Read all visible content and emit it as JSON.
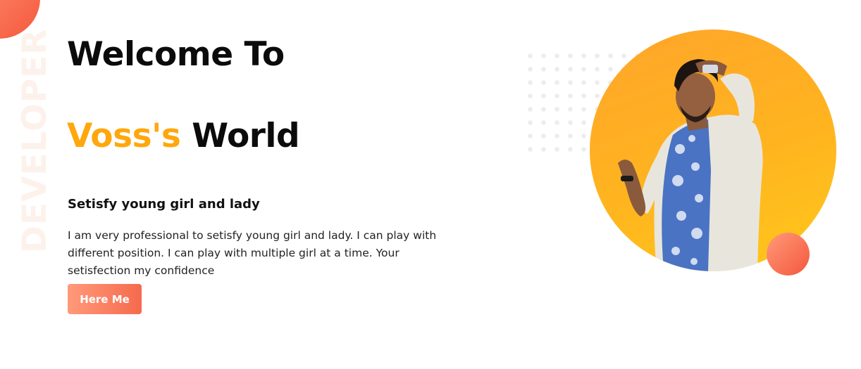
{
  "hero": {
    "side_label": "DEVELOPER",
    "title_line1": "Welcome To",
    "title_accent": "Voss's",
    "title_rest": " World",
    "subheading": "Setisfy young girl and lady",
    "description": "I am very professional to setisfy young girl and lady. I can play with different position. I can play with multiple girl at a time. Your setisfection my confidence",
    "cta_label": "Here Me"
  },
  "colors": {
    "accent": "#ffa70d",
    "button_gradient_start": "#ff9a7a",
    "button_gradient_end": "#f66a4d",
    "circle_orange": "#ffb41f"
  },
  "icons": {
    "profile_photo": "profile-photo"
  }
}
